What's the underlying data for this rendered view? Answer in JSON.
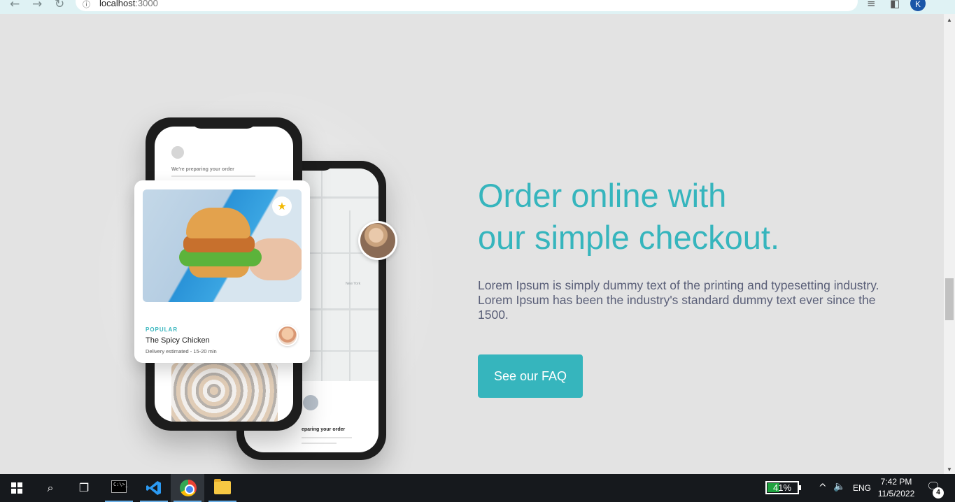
{
  "browser": {
    "back_icon": "←",
    "forward_icon": "→",
    "reload_icon": "↻",
    "info_icon": "ⓘ",
    "url_host": "localhost",
    "url_port": ":3000",
    "share_icon": "⇪",
    "star_icon": "☆",
    "media_icon": "≡",
    "sidepanel_icon": "◧",
    "profile_initial": "K"
  },
  "hero": {
    "headline_line1": "Order online with",
    "headline_line2": "our simple checkout.",
    "body": "Lorem Ipsum is simply dummy text of the printing and typesetting industry. Lorem Ipsum has been the industry's standard dummy text ever since the 1500.",
    "cta_label": "See our FAQ"
  },
  "phone_front": {
    "preparing_title": "We're preparing your order"
  },
  "phone_back": {
    "map_label_city": "New York",
    "preparing_title": "eparing your order"
  },
  "food_card": {
    "tag": "POPULAR",
    "title": "The Spicy Chicken",
    "subtitle": "Delivery estimated - 15-20 min",
    "fav_icon": "★"
  },
  "taskbar": {
    "search_icon": "⌕",
    "taskview_icon": "❐",
    "cmd_text": "C:\\>_",
    "battery_percent": "41%",
    "battery_level": 0.41,
    "tray_chevron": "^",
    "volume_icon": "🔈",
    "language": "ENG",
    "time": "7:42 PM",
    "date": "11/5/2022",
    "notifications_icon": "🗨",
    "notifications_count": "4"
  },
  "colors": {
    "accent": "#36b5bd",
    "body_text": "#5a5f78",
    "page_bg": "#e3e3e3"
  }
}
